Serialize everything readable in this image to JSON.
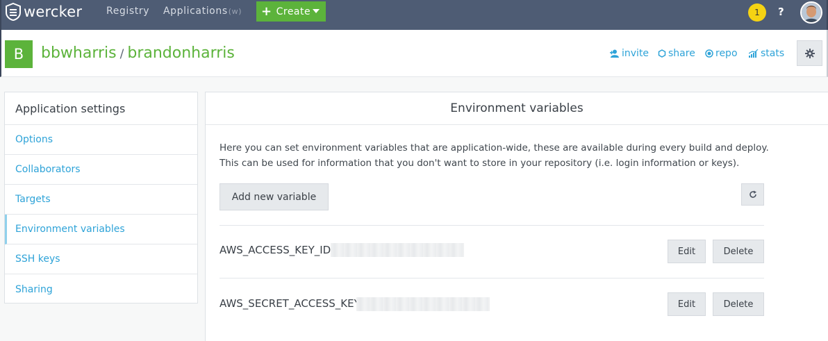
{
  "nav": {
    "logo_text": "wercker",
    "registry": "Registry",
    "applications": "Applications",
    "applications_shortcut": "(w)",
    "create": "Create",
    "notifications_count": "1",
    "help": "?"
  },
  "app": {
    "badge": "B",
    "owner": "bbwharris",
    "separator": "/",
    "name": "brandonharris",
    "links": {
      "invite": "invite",
      "share": "share",
      "repo": "repo",
      "stats": "stats"
    }
  },
  "sidebar": {
    "title": "Application settings",
    "items": [
      {
        "label": "Options"
      },
      {
        "label": "Collaborators"
      },
      {
        "label": "Targets"
      },
      {
        "label": "Environment variables",
        "active": true
      },
      {
        "label": "SSH keys"
      },
      {
        "label": "Sharing"
      }
    ]
  },
  "main": {
    "title": "Environment variables",
    "description_line1": "Here you can set environment variables that are application-wide, these are available during every build and deploy.",
    "description_line2": "This can be used for information that you don't want to store in your repository (i.e. login information or keys).",
    "add_button": "Add new variable",
    "variables": [
      {
        "name": "AWS_ACCESS_KEY_ID",
        "edit": "Edit",
        "delete": "Delete"
      },
      {
        "name": "AWS_SECRET_ACCESS_KEY",
        "edit": "Edit",
        "delete": "Delete"
      }
    ]
  },
  "colors": {
    "nav_bg": "#4e5c74",
    "brand_green": "#5cb33b",
    "link_blue": "#2ea3d8",
    "badge_yellow": "#f5d313"
  },
  "icons": [
    "wercker-logo-icon",
    "plus-icon",
    "caret-down-icon",
    "invite-icon",
    "share-icon",
    "repo-icon",
    "stats-icon",
    "gear-icon",
    "refresh-icon"
  ]
}
